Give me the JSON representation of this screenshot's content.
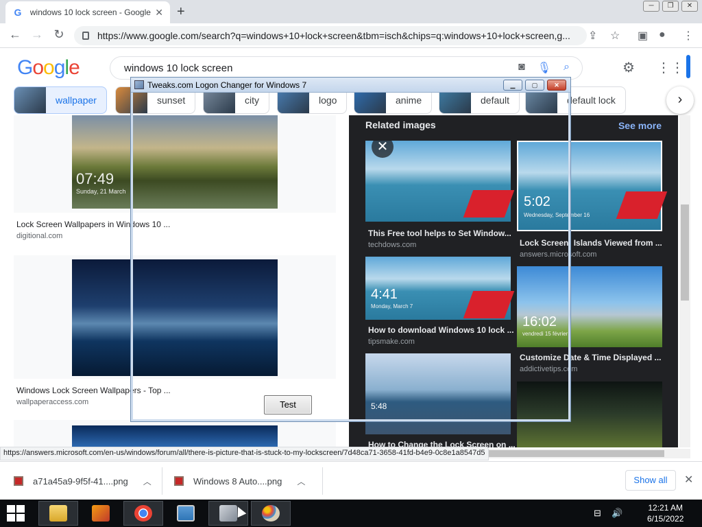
{
  "browser": {
    "tab_title": "windows 10 lock screen - Google",
    "tab_favicon": "G",
    "url": "https://www.google.com/search?q=windows+10+lock+screen&tbm=isch&chips=q:windows+10+lock+screen,g...",
    "new_tab_symbol": "+",
    "close_symbol": "✕"
  },
  "google": {
    "logo_letters": [
      "G",
      "o",
      "o",
      "g",
      "l",
      "e"
    ],
    "logo_colors": [
      "#4285f4",
      "#ea4335",
      "#fbbc05",
      "#4285f4",
      "#34a853",
      "#ea4335"
    ],
    "query": "windows 10 lock screen"
  },
  "chips": [
    {
      "label": "wallpaper",
      "active": true,
      "color": "#6a8fb5"
    },
    {
      "label": "sunset",
      "active": false,
      "color": "#d98a3d"
    },
    {
      "label": "city",
      "active": false,
      "color": "#7c8da0"
    },
    {
      "label": "logo",
      "active": false,
      "color": "#4a7fb5"
    },
    {
      "label": "anime",
      "active": false,
      "color": "#2f6fb3"
    },
    {
      "label": "default",
      "active": false,
      "color": "#3f7fa8"
    },
    {
      "label": "default lock",
      "active": false,
      "color": "#6d8ca8"
    }
  ],
  "results": [
    {
      "title": "Lock Screen Wallpapers in Windows 10 ...",
      "source": "digitional.com",
      "time": "07:49",
      "date": "Sunday, 21 March"
    },
    {
      "title": "Windows Lock Screen Wallpapers - Top ...",
      "source": "wallpaperaccess.com"
    }
  ],
  "related": {
    "heading": "Related images",
    "see_more": "See more",
    "items": [
      {
        "title": "This Free tool helps to Set Window...",
        "source": "techdows.com"
      },
      {
        "title": "Lock Screen: Islands Viewed from ...",
        "source": "answers.microsoft.com",
        "time": "5:02",
        "date": "Wednesday, September 16"
      },
      {
        "title": "How to download Windows 10 lock ...",
        "source": "tipsmake.com",
        "time": "4:41",
        "date": "Monday, March 7"
      },
      {
        "title": "Customize Date & Time Displayed ...",
        "source": "addictivetips.com",
        "time": "16:02",
        "date": "vendredi 15 février"
      },
      {
        "title": "How to Change the Lock Screen on ...",
        "source": "",
        "time": "5:48",
        "date": ""
      }
    ]
  },
  "status_url": "https://answers.microsoft.com/en-us/windows/forum/all/there-is-picture-that-is-stuck-to-my-lockscreen/7d48ca71-3658-41fd-b4e9-0c8e1a8547d5",
  "downloads": {
    "items": [
      {
        "name": "a71a45a9-9f5f-41....png"
      },
      {
        "name": "Windows 8 Auto....png"
      }
    ],
    "show_all": "Show all"
  },
  "dialog": {
    "title": "Tweaks.com Logon Changer for Windows 7",
    "test_label": "Test"
  },
  "taskbar": {
    "time": "12:21 AM",
    "date": "6/15/2022"
  }
}
